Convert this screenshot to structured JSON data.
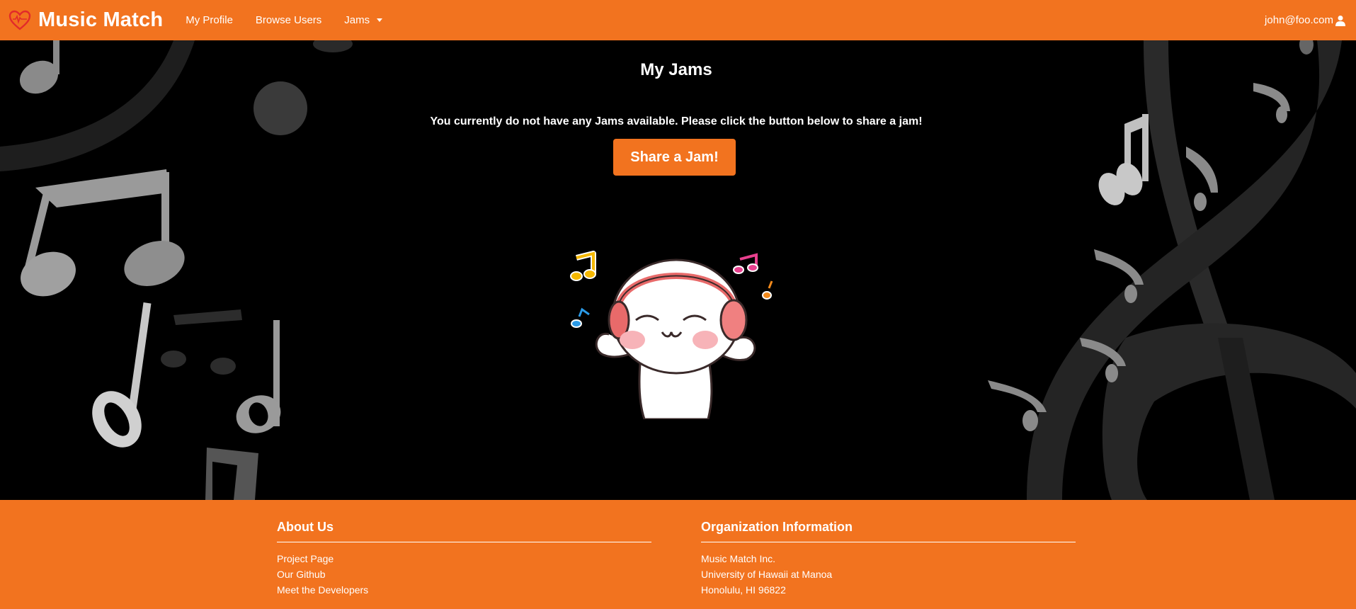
{
  "navbar": {
    "brand": "Music Match",
    "links": [
      {
        "label": "My Profile"
      },
      {
        "label": "Browse Users"
      },
      {
        "label": "Jams"
      }
    ],
    "user_email": "john@foo.com"
  },
  "main": {
    "title": "My Jams",
    "empty_message": "You currently do not have any Jams available. Please click the button below to share a jam!",
    "share_button": "Share a Jam!"
  },
  "footer": {
    "about": {
      "heading": "About Us",
      "links": [
        "Project Page",
        "Our Github",
        "Meet the Developers"
      ]
    },
    "org": {
      "heading": "Organization Information",
      "lines": [
        "Music Match Inc.",
        "University of Hawaii at Manoa",
        "Honolulu, HI 96822"
      ]
    }
  },
  "colors": {
    "brand_orange": "#f2731f",
    "background": "#000000"
  },
  "icons": [
    "heart-logo-icon",
    "caret-down-icon",
    "user-icon",
    "music-note-icon"
  ]
}
